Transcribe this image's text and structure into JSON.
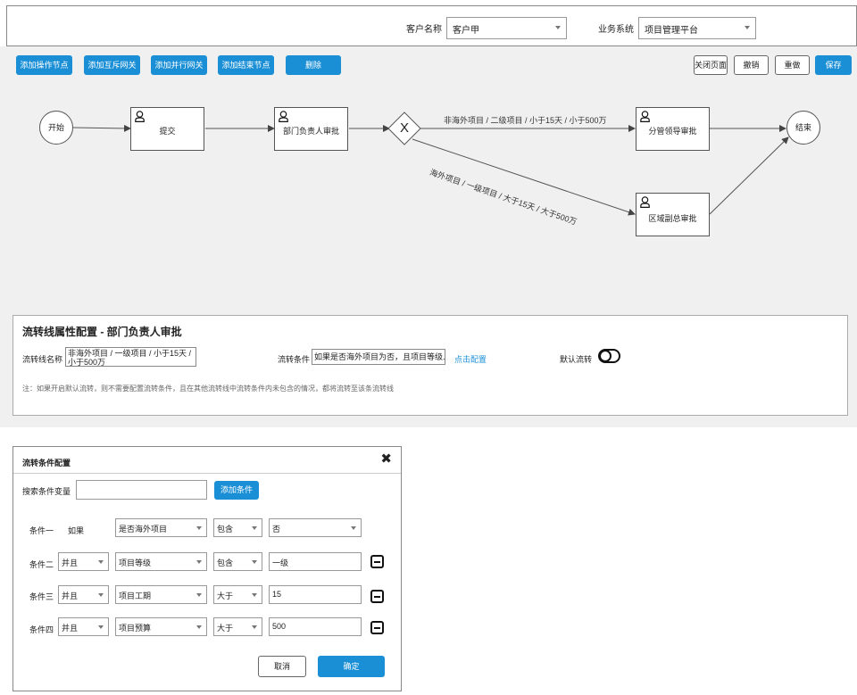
{
  "header": {
    "customer_label": "客户名称",
    "customer_value": "客户甲",
    "system_label": "业务系统",
    "system_value": "项目管理平台"
  },
  "toolbar": {
    "add_operation_node": "添加操作节点",
    "add_exclusive_gateway": "添加互斥网关",
    "add_parallel_gateway": "添加并行网关",
    "add_end_node": "添加结束节点",
    "delete": "删除",
    "close_page": "关闭页面",
    "undo": "撤销",
    "redo": "重做",
    "save": "保存"
  },
  "flow": {
    "start": "开始",
    "submit": "提交",
    "dept_approval": "部门负责人审批",
    "gateway_symbol": "X",
    "leader_approval": "分管领导审批",
    "regional_approval": "区域副总审批",
    "end": "结束",
    "edge_upper": "非海外项目 / 二级项目 / 小于15天 / 小于500万",
    "edge_lower": "海外项目 / 一级项目 / 大于15天 / 大于500万"
  },
  "properties": {
    "title": "流转线属性配置 - 部门负责人审批",
    "name_label": "流转线名称",
    "name_value": "非海外项目 / 一级项目 / 小于15天 / 小于500万",
    "condition_label": "流转条件",
    "condition_value": "如果是否海外项目为否，且项目等级...",
    "config_link": "点击配置",
    "default_label": "默认流转",
    "note": "注：如果开启默认流转，则不需要配置流转条件，且在其他流转线中流转条件内未包含的情况，都将流转至该条流转线"
  },
  "dialog": {
    "title": "流转条件配置",
    "search_label": "搜索条件变量",
    "search_value": "",
    "add_condition": "添加条件",
    "conditions": [
      {
        "label": "条件一",
        "connector": "如果",
        "variable": "是否海外项目",
        "operator": "包含",
        "value": "否"
      },
      {
        "label": "条件二",
        "connector": "并且",
        "variable": "项目等级",
        "operator": "包含",
        "value": "一级"
      },
      {
        "label": "条件三",
        "connector": "并且",
        "variable": "项目工期",
        "operator": "大于",
        "value": "15"
      },
      {
        "label": "条件四",
        "connector": "并且",
        "variable": "项目预算",
        "operator": "大于",
        "value": "500"
      }
    ],
    "cancel": "取消",
    "confirm": "确定"
  },
  "colors": {
    "primary": "#1a8fd6",
    "canvas_bg": "#f0f0f0",
    "link": "#1a8fd6"
  }
}
